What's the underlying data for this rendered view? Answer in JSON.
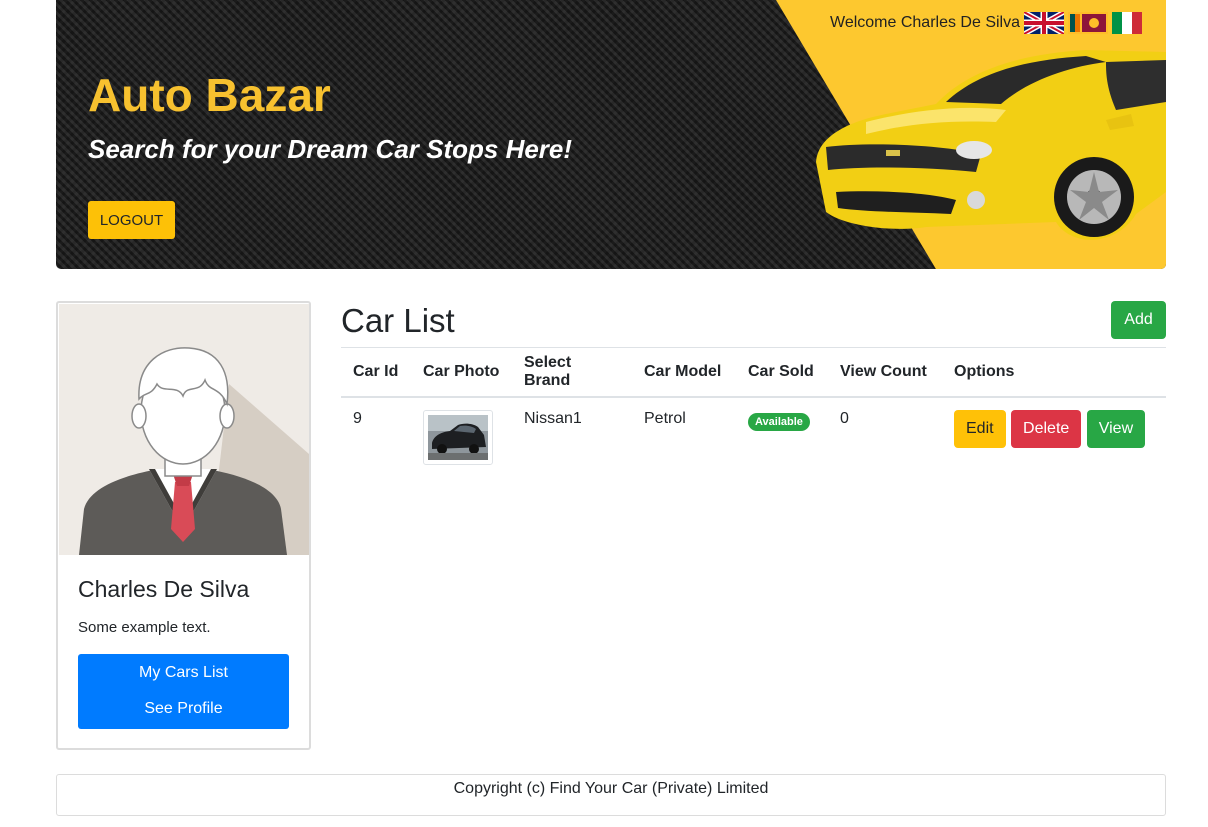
{
  "header": {
    "brand_title": "Auto Bazar",
    "tagline": "Search for your Dream Car Stops Here!",
    "logout_label": "LOGOUT",
    "welcome_text": "Welcome Charles De Silva",
    "languages": [
      "uk-flag-icon",
      "sri-lanka-flag-icon",
      "italy-flag-icon"
    ],
    "accent_color": "#f7c12f"
  },
  "profile": {
    "name": "Charles De Silva",
    "text": "Some example text.",
    "links": [
      "My Cars List",
      "See Profile"
    ]
  },
  "car_list": {
    "title": "Car List",
    "add_label": "Add",
    "columns": [
      "Car Id",
      "Car Photo",
      "Select Brand",
      "Car Model",
      "Car Sold",
      "View Count",
      "Options"
    ],
    "rows": [
      {
        "id": "9",
        "brand": "Nissan1",
        "model": "Petrol",
        "status": "Available",
        "views": "0",
        "actions": [
          "Edit",
          "Delete",
          "View"
        ]
      }
    ]
  },
  "footer": {
    "copyright": "Copyright (c) Find Your Car (Private) Limited"
  }
}
